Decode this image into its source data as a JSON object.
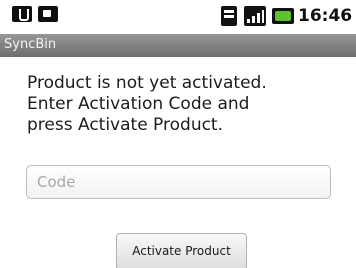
{
  "status_bar": {
    "time": "16:46",
    "icons": [
      "usb-debug-icon",
      "photo-notification-icon",
      "sd-card-icon",
      "signal-icon",
      "battery-icon"
    ],
    "battery_color": "#5ec02e"
  },
  "app": {
    "title": "SyncBin",
    "title_bar_color": "#7f7f7f"
  },
  "message": {
    "lines": [
      "Product is not yet activated.",
      "Enter Activation Code and",
      "press Activate Product."
    ]
  },
  "code_field": {
    "placeholder": "Code",
    "value": ""
  },
  "actions": {
    "activate_label": "Activate Product"
  }
}
